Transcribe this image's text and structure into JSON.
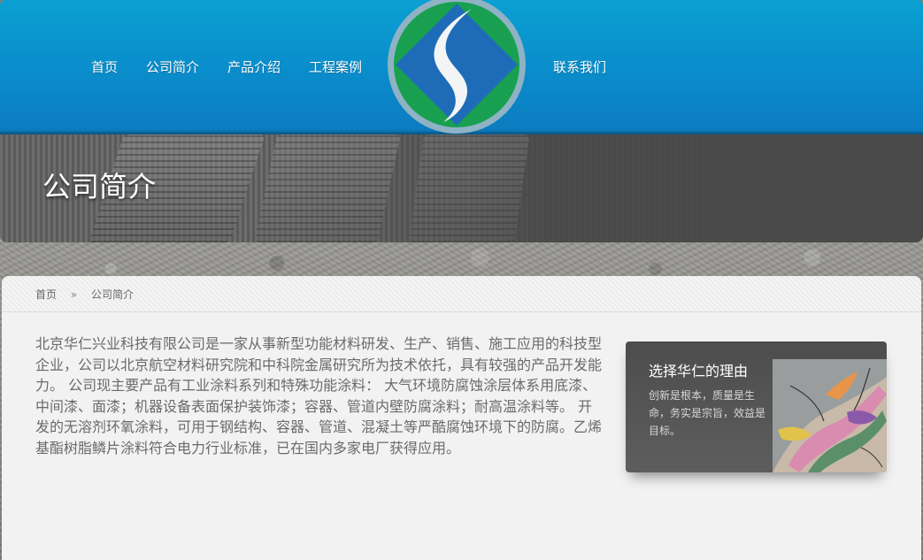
{
  "nav": {
    "home": "首页",
    "about": "公司简介",
    "products": "产品介绍",
    "cases": "工程案例",
    "contact": "联系我们"
  },
  "logo": {
    "icon": "flame-diamond-logo-icon",
    "colors": {
      "ring": "#8fb2c4",
      "green": "#18a050",
      "blue": "#1e6cb8",
      "white": "#f2f4f6"
    }
  },
  "banner": {
    "title": "公司简介"
  },
  "breadcrumb": {
    "home": "首页",
    "separator": "»",
    "current": "公司简介"
  },
  "intro": {
    "text": "北京华仁兴业科技有限公司是一家从事新型功能材料研发、生产、销售、施工应用的科技型企业，公司以北京航空材料研究院和中科院金属研究所为技术依托，具有较强的产品开发能力。 公司现主要产品有工业涂料系列和特殊功能涂料： 大气环境防腐蚀涂层体系用底漆、中间漆、面漆；机器设备表面保护装饰漆；容器、管道内壁防腐涂料；耐高温涂料等。 开发的无溶剂环氧涂料，可用于钢结构、容器、管道、混凝土等严酷腐蚀环境下的防腐。乙烯基酯树脂鳞片涂料符合电力行业标准，已在国内多家电厂获得应用。"
  },
  "sidebar": {
    "title": "选择华仁的理由",
    "body": "创新是根本，质量是生命，务实是宗旨，效益是目标。"
  },
  "colors": {
    "header_blue": "#0a8ccb",
    "banner_gray": "#4a4a4a",
    "panel_bg": "#f2f2f2",
    "text_gray": "#6a6a6a"
  }
}
